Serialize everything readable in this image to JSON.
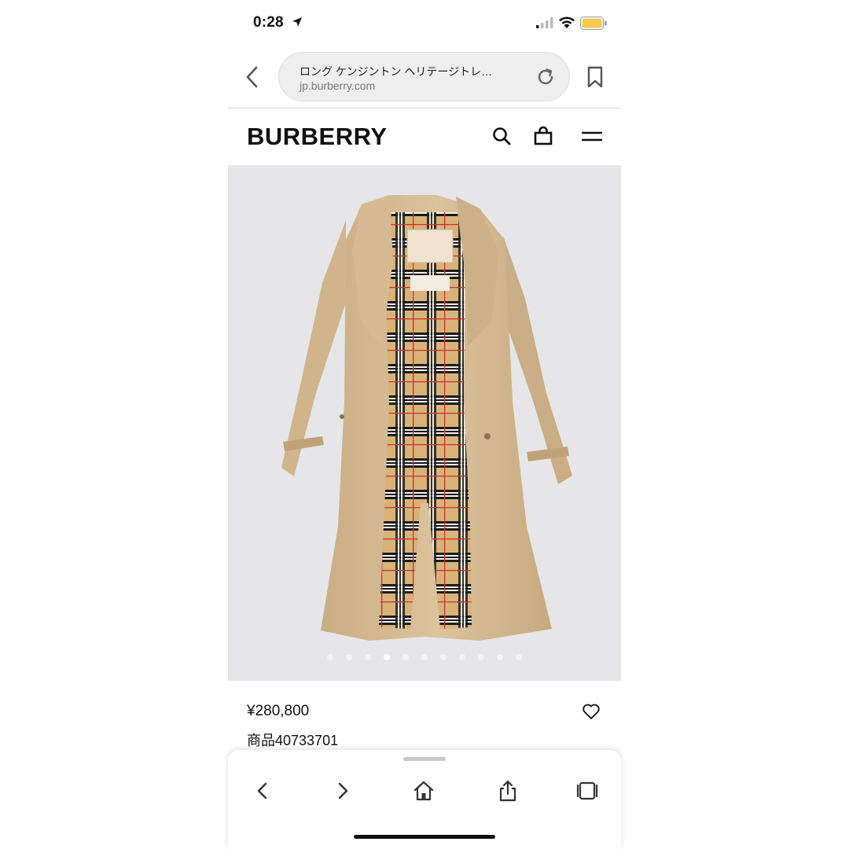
{
  "status_bar": {
    "time": "0:28"
  },
  "browser": {
    "page_title": "ロング ケンジントン ヘリテージトレ…",
    "domain": "jp.burberry.com"
  },
  "site": {
    "logo": "BURBERRY"
  },
  "product": {
    "price": "¥280,800",
    "sku": "商品40733701",
    "image_count": 11,
    "active_image_index": 3
  },
  "colors": {
    "coat_beige": "#d8bf98",
    "check_camel": "#d9b27a",
    "image_bg": "#e6e6e8",
    "battery_yellow": "#f2c94c"
  }
}
